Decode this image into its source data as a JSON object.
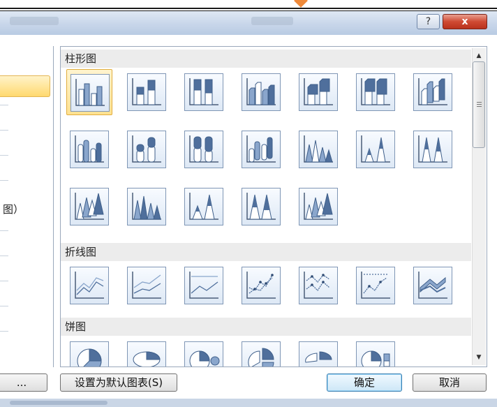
{
  "window": {
    "help_label": "?",
    "close_label": "x"
  },
  "left": {
    "partial_label": "图）"
  },
  "categories": [
    {
      "label": "柱形图"
    },
    {
      "label": "折线图"
    },
    {
      "label": "饼图"
    }
  ],
  "icons": {
    "selected": "clustered-column-icon"
  },
  "buttons": {
    "more_label": "...",
    "set_default_label": "设置为默认图表(S)",
    "ok_label": "确定",
    "cancel_label": "取消"
  }
}
